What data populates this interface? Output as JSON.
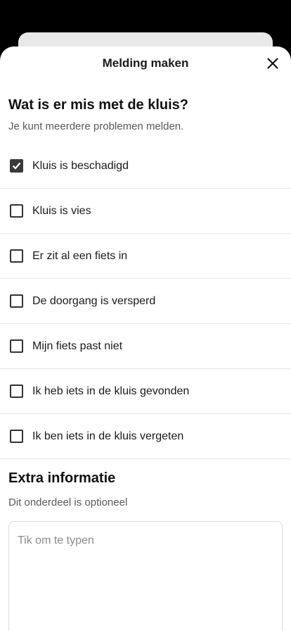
{
  "sheet": {
    "title": "Melding maken",
    "close_icon": "close-icon"
  },
  "question": {
    "title": "Wat is er mis met de kluis?",
    "subtitle": "Je kunt meerdere problemen melden."
  },
  "options": [
    {
      "label": "Kluis is beschadigd",
      "checked": true
    },
    {
      "label": "Kluis is vies",
      "checked": false
    },
    {
      "label": "Er zit al een fiets in",
      "checked": false
    },
    {
      "label": "De doorgang is versperd",
      "checked": false
    },
    {
      "label": "Mijn fiets past niet",
      "checked": false
    },
    {
      "label": "Ik heb iets in de kluis gevonden",
      "checked": false
    },
    {
      "label": "Ik ben iets in de kluis vergeten",
      "checked": false
    }
  ],
  "extra": {
    "title": "Extra informatie",
    "subtitle": "Dit onderdeel is optioneel",
    "placeholder": "Tik om te typen"
  },
  "colors": {
    "checkbox_checked": "#3a3a3a",
    "background": "#000000",
    "sheet": "#ffffff"
  }
}
